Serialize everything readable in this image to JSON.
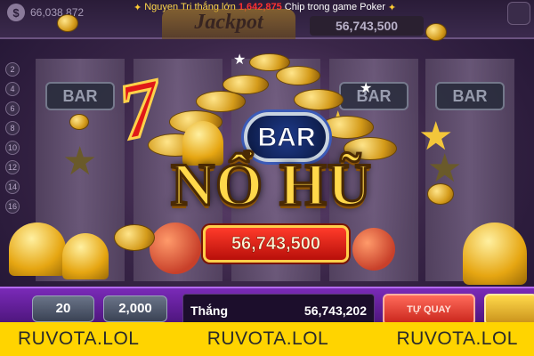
{
  "topbar": {
    "balance_icon": "dollar-coin-icon",
    "balance_symbol": "$",
    "balance": "66,038,872",
    "ticker": {
      "prefix": "Nguyen Tri thắng lớn",
      "amount": "1,642,875",
      "suffix": "Chip trong game Poker",
      "icon": "firework-icon"
    },
    "jackpot_label": "Jackpot",
    "jackpot_value": "56,743,500"
  },
  "paylines": [
    "2",
    "4",
    "6",
    "8",
    "10",
    "12",
    "14",
    "16"
  ],
  "reel_symbol": "BAR",
  "emblem": "BAR",
  "headline": "NỔ HŨ",
  "win_amount": "56,743,500",
  "controls": {
    "lines": "20",
    "bet": "2,000",
    "win_label": "Thắng",
    "win_value": "56,743,202",
    "spin_label": "TỰ QUAY"
  },
  "watermark": [
    "RUVOTA.LOL",
    "RUVOTA.LOL",
    "RUVOTA.LOL"
  ],
  "colors": {
    "accent_gold": "#ffd84a",
    "win_red": "#d81e14",
    "control_purple": "#7a2ab8",
    "watermark_yellow": "#ffd400"
  }
}
